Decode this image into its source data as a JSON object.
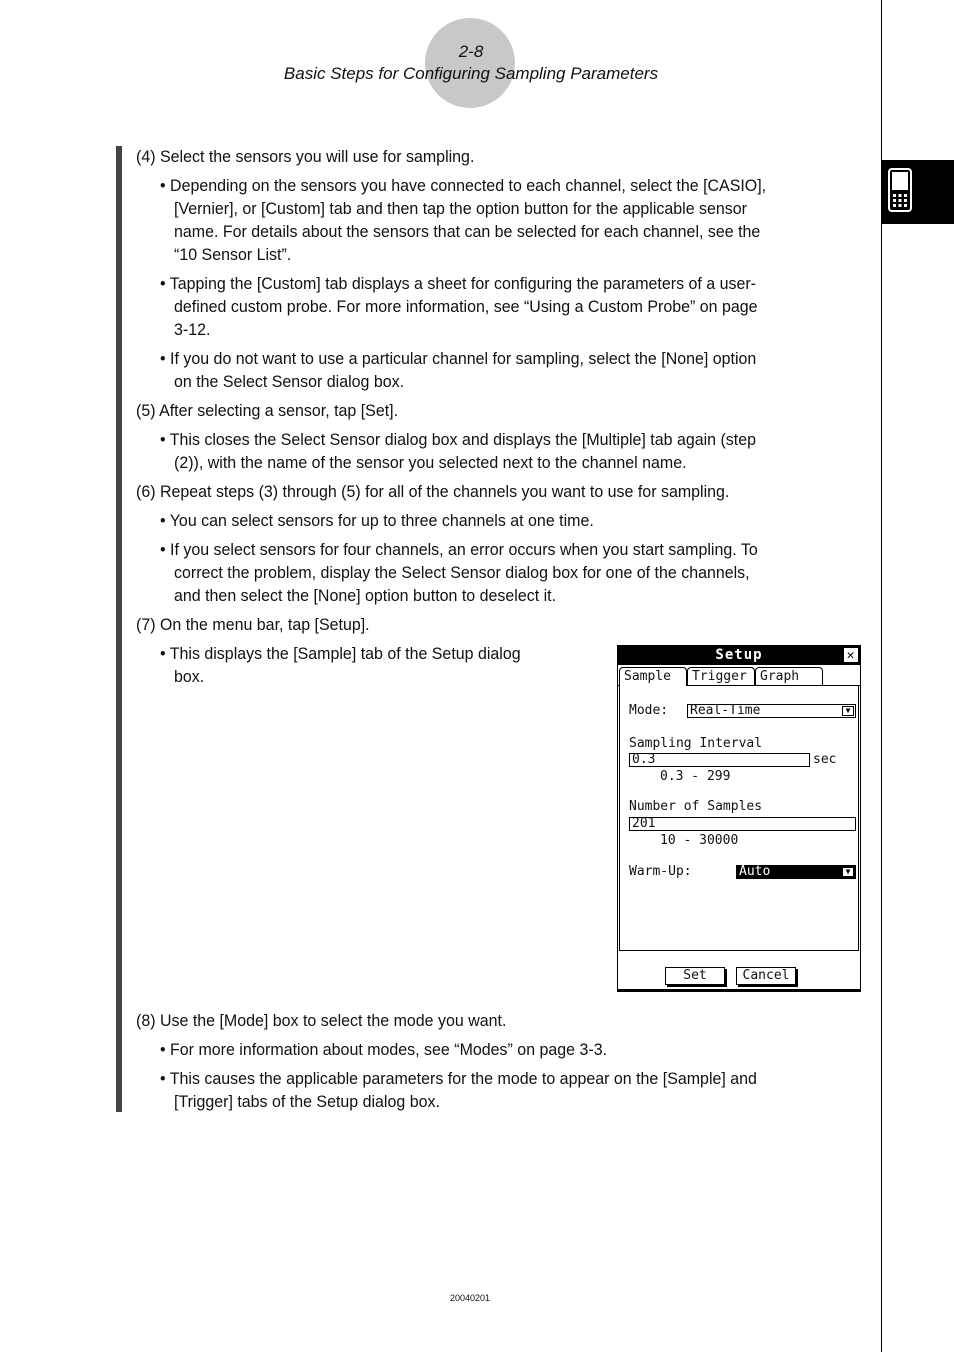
{
  "header": {
    "page_number": "2-8",
    "section_title": "Basic Steps for Configuring Sampling Parameters"
  },
  "side_tab": {
    "icon": "calculator-icon"
  },
  "content": {
    "step4": "(4) Select the sensors you will use for sampling.",
    "step4_b1_l1": "• Depending on the sensors you have connected to each channel, select the [CASIO],",
    "step4_b1_l2": "[Vernier], or [Custom] tab and then tap the option button for the applicable sensor",
    "step4_b1_l3": "name. For details about the sensors that can be selected for each channel, see the",
    "step4_b1_l4": "“10 Sensor List”.",
    "step4_b2_l1": "• Tapping the [Custom] tab displays a sheet for configuring the parameters of a user-",
    "step4_b2_l2": "defined custom probe. For more information, see “Using a Custom Probe” on page",
    "step4_b2_l3": "3-12.",
    "step4_b3_l1": "• If you do not want to use a particular channel for sampling, select the [None] option",
    "step4_b3_l2": "on the Select Sensor dialog box.",
    "step5": "(5) After selecting a sensor, tap [Set].",
    "step5_b1_l1": "• This closes the Select Sensor dialog box and displays the [Multiple] tab again (step",
    "step5_b1_l2": "(2)), with the name of the sensor you selected next to the channel name.",
    "step6": "(6) Repeat steps (3) through (5) for all of the channels you want to use for sampling.",
    "step6_b1": "• You can select sensors for up to three channels at one time.",
    "step6_b2_l1": "• If you select sensors for four channels, an error occurs when you start sampling. To",
    "step6_b2_l2": "correct the problem, display the Select Sensor dialog box for one of the channels,",
    "step6_b2_l3": "and then select the [None] option button to deselect it.",
    "step7": "(7) On the menu bar, tap [Setup].",
    "step7_b1_l1": "• This displays the [Sample] tab of the Setup dialog",
    "step7_b1_l2": "box.",
    "step8": "(8) Use the [Mode] box to select the mode you want.",
    "step8_b1": "• For more information about modes, see “Modes” on page 3-3.",
    "step8_b2_l1": "• This causes the applicable parameters for the mode to appear on the [Sample] and",
    "step8_b2_l2": "[Trigger] tabs of the Setup dialog box."
  },
  "dialog": {
    "title": "Setup",
    "close_glyph": "✕",
    "tabs": [
      {
        "label": "Sample",
        "active": true
      },
      {
        "label": "Trigger",
        "active": false
      },
      {
        "label": "Graph",
        "active": false
      }
    ],
    "mode_label": "Mode:",
    "mode_value": "Real-Time",
    "interval_label": "Sampling Interval",
    "interval_value": "0.3",
    "interval_unit": "sec",
    "interval_range": "0.3 - 299",
    "samples_label": "Number of Samples",
    "samples_value": "201",
    "samples_range": "10 - 30000",
    "warmup_label": "Warm-Up:",
    "warmup_value": "Auto",
    "dropdown_glyph": "▼",
    "set_button": "Set",
    "cancel_button": "Cancel"
  },
  "footer": {
    "code": "20040201"
  }
}
